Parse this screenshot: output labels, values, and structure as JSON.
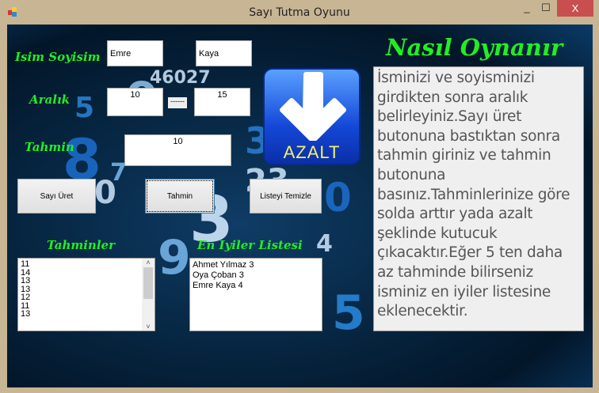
{
  "window": {
    "title": "Sayı Tutma Oyunu",
    "minimize": "_",
    "maximize": "☐",
    "close": "X"
  },
  "labels": {
    "name": "Isim Soyisim",
    "range": "Aralık",
    "guess": "Tahmin",
    "guesses": "Tahminler",
    "best": "En Iyiler Listesi",
    "howto": "Nasıl Oynanır"
  },
  "inputs": {
    "first_name": "Emre",
    "last_name": "Kaya",
    "range_min": "10",
    "range_sep": "------",
    "range_max": "15",
    "guess": "10"
  },
  "buttons": {
    "generate": "Sayı Üret",
    "guess": "Tahmin",
    "clear": "Listeyi Temizle"
  },
  "hint": {
    "text": "AZALT",
    "icon": "arrow-down-icon"
  },
  "guess_list": [
    "11",
    "14",
    "13",
    "13",
    "12",
    "11",
    "13"
  ],
  "best_list": [
    "Ahmet Yılmaz 3",
    "Oya Çoban 3",
    "Emre Kaya 4"
  ],
  "help_text": "İsminizi ve soyisminizi girdikten sonra aralık belirleyiniz.Sayı üret butonuna bastıktan sonra tahmin giriniz ve tahmin butonuna basınız.Tahminlerinize göre solda arttır yada azalt şeklinde kutucuk çıkacaktır.Eğer 5 ten daha az tahminde bilirseniz isminiz en iyiler listesine eklenecektir."
}
